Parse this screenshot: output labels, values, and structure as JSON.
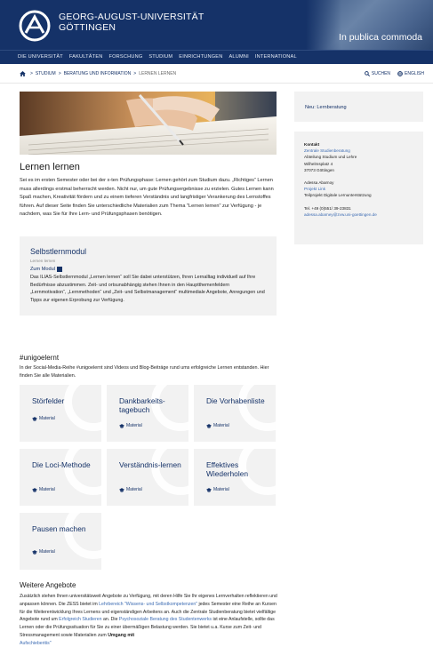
{
  "header": {
    "logo_line1": "GEORG-AUGUST-UNIVERSITÄT",
    "logo_line2": "GÖTTINGEN",
    "motto": "In publica commoda",
    "colors": {
      "primary": "#153268",
      "link": "#3d6cb3",
      "box": "#f2f2f2"
    }
  },
  "nav": {
    "items": [
      "DIE UNIVERSITÄT",
      "FAKULTÄTEN",
      "FORSCHUNG",
      "STUDIUM",
      "EINRICHTUNGEN",
      "ALUMNI",
      "INTERNATIONAL"
    ]
  },
  "breadcrumb": {
    "home_icon": "home-icon",
    "items": [
      "STUDIUM",
      "BERATUNG UND INFORMATION",
      "LERNEN LERNEN"
    ]
  },
  "tools": {
    "search": "SUCHEN",
    "english": "ENGLISH"
  },
  "page": {
    "title": "Lernen lernen",
    "intro": "Sei es im ersten Semester oder bei der x-ten Prüfungsphase: Lernen gehört zum Studium dazu. „Richtiges“ Lernen muss allerdings erstmal beherrscht werden. Nicht nur, um gute Prüfungsergebnisse zu erzielen. Gutes Lernen kann Spaß machen, Kreativität fördern und zu einem tieferen Verständnis und langfristiger Verankerung des Lernstoffes führen. Auf dieser Seite finden Sie unterschiedliche Materialien zum Thema \"Lernen lernen\" zur Verfügung - je nachdem, was Sie für Ihre Lern- und Prüfungsphasen benötigen."
  },
  "module": {
    "title": "Selbstlernmodul",
    "subtitle": "Lernen lernen",
    "link": "Zum Modul",
    "description": "Das ILIAS-Selbstlernmodul „Lernen lernen“ soll Sie dabei unterstützen, Ihren Lernalltag individuell auf Ihre Bedürfnisse abzustimmen. Zeit- und ortsunabhängig stehen Ihnen in den Hauptthemenfeldern „Lernmotivation“, „Lernmethoden“ und „Zeit- und Selbstmanagement“ multimediale Angebote, Anregungen und Tipps zur eigenen Erprobung zur Verfügung."
  },
  "unigoelernt": {
    "title": "#unigoelernt",
    "description": "In der Social-Media-Reihe #unigoelernt sind Videos und Blog-Beiträge rund ums erfolgreiche Lernen entstanden. Hier finden Sie alle Materialien.",
    "material_label": "Material",
    "tiles": [
      {
        "name": "Störfelder"
      },
      {
        "name": "Dankbarkeits-tagebuch"
      },
      {
        "name": "Die Vorhabenliste"
      },
      {
        "name": "Die Loci-Methode"
      },
      {
        "name": "Verständnis-lernen"
      },
      {
        "name": "Effektives Wiederholen"
      },
      {
        "name": "Pausen machen"
      }
    ]
  },
  "more": {
    "title": "Weitere Angebote",
    "p1": "Zusätzlich stehen Ihnen universitätsweit Angebote zu Verfügung, mit deren Hilfe Sie Ihr eigenes Lernverhalten reflektieren und anpassen können. Die ZESS bietet im ",
    "l1": "Lehrbereich \"Wissens- und Selbstkompetenzen\"",
    "p2": " jedes Semester eine Reihe an Kursen für die Weiterentwicklung Ihres Lernens und eigenständigen Arbeitens an. Auch die Zentrale Studienberatung bietet vielfältige Angebote rund um ",
    "l2": "Erfolgreich Studieren",
    "p3": " an. Die ",
    "l3": "Psychosoziale Beratung des Studentenwerks",
    "p4": " ist eine Anlaufstelle, sollte das Lernen oder die Prüfungssituation für Sie zu einer übermäßigen Belastung werden. Sie bietet u.a. Kurse zum Zeit- und Stressmanagement sowie Materialien zum ",
    "p5": "Umgang mit",
    "l4": "Aufschieberitis\""
  },
  "sidebar": {
    "news_link": "Neu: Lernberatung",
    "contact": {
      "heading": "Kontakt",
      "org_link": "Zentrale Studienberatung",
      "dept": "Abteilung Studium und Lehre",
      "street": "Wilhelmsplatz 4",
      "city": "37073 Göttingen",
      "person": "Adessa Abarnoy",
      "project_link": "Projekt Link",
      "project": "Teilprojekt Digitale Lernunterstützung",
      "phone": "Tel. +49 (0)551/ 39-23831",
      "email": "adessa.abarney@zvw.uni-goettingen.de"
    }
  }
}
